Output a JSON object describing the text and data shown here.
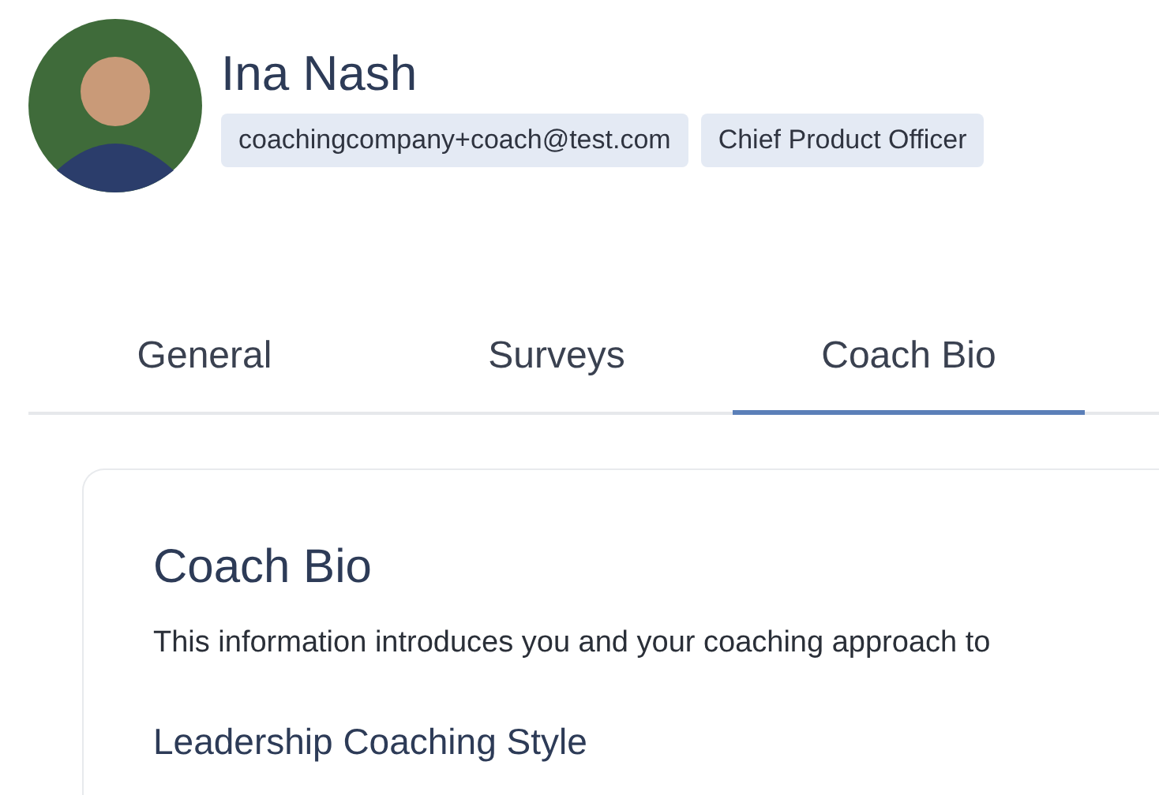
{
  "profile": {
    "name": "Ina Nash",
    "badges": [
      "coachingcompany+coach@test.com",
      "Chief Product Officer"
    ]
  },
  "tabs": [
    {
      "label": "General",
      "selected": false
    },
    {
      "label": "Surveys",
      "selected": false
    },
    {
      "label": "Coach Bio",
      "selected": true
    }
  ],
  "card": {
    "title": "Coach Bio",
    "description": "This information introduces you and your coaching approach to",
    "section_heading": "Leadership Coaching Style"
  }
}
